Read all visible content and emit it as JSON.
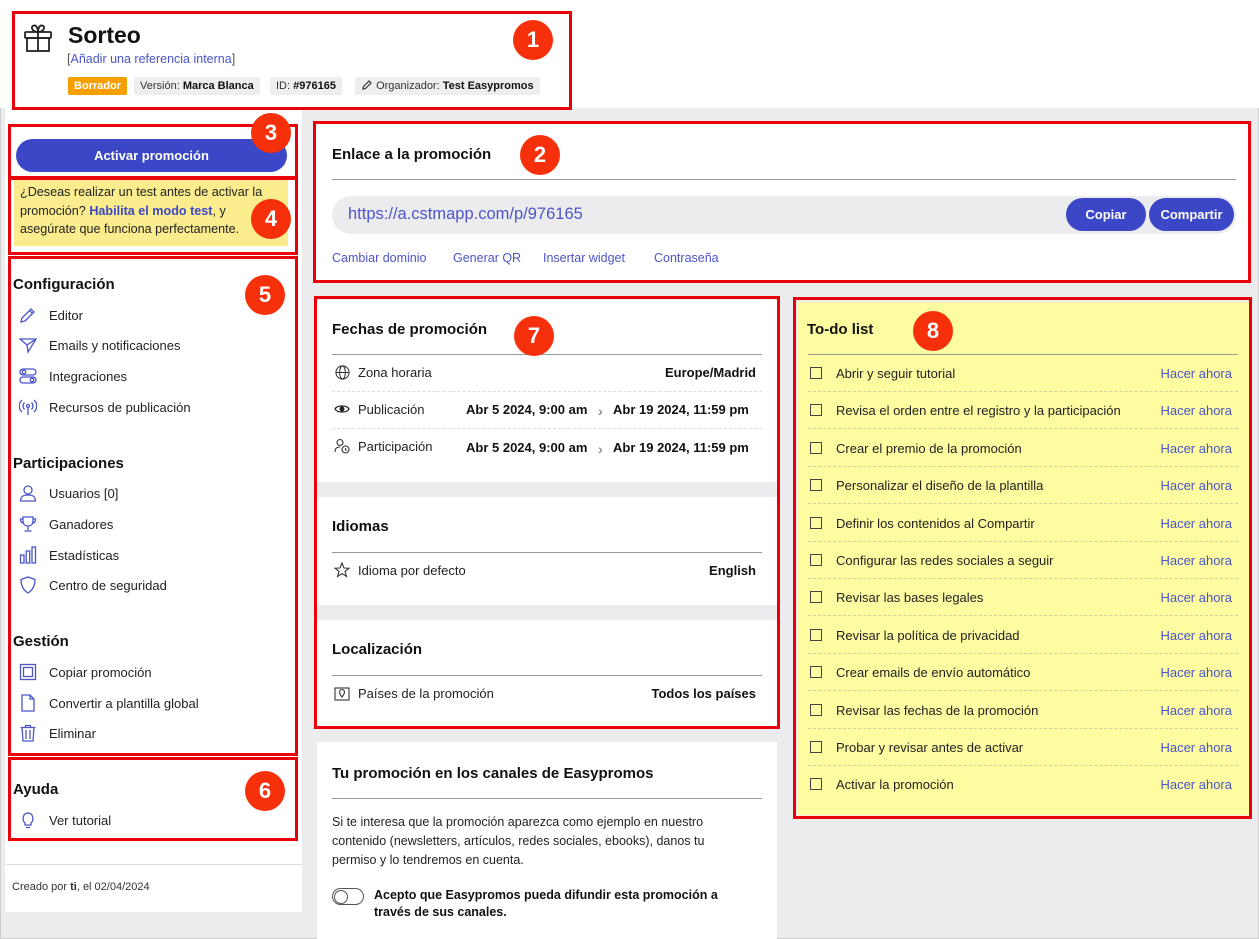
{
  "header": {
    "title": "Sorteo",
    "ref_open": "[",
    "ref_link": "Añadir una referencia interna",
    "ref_close": "]",
    "status": "Borrador",
    "version_label": "Versión:",
    "version_value": "Marca Blanca",
    "id_label": "ID:",
    "id_value": "#976165",
    "organizer_label": "Organizador:",
    "organizer_value": "Test Easypromos"
  },
  "sidebar": {
    "activate_button": "Activar promoción",
    "notice_text_1": "¿Deseas realizar un test antes de activar la promoción?",
    "notice_link": "Habilita el modo test",
    "notice_text_2": ", y asegúrate que funciona perfectamente.",
    "sections": [
      {
        "title": "Configuración",
        "items": [
          {
            "label": "Editor",
            "icon": "pencil-icon"
          },
          {
            "label": "Emails y notificaciones",
            "icon": "send-icon"
          },
          {
            "label": "Integraciones",
            "icon": "toggles-icon"
          },
          {
            "label": "Recursos de publicación",
            "icon": "broadcast-icon"
          }
        ]
      },
      {
        "title": "Participaciones",
        "items": [
          {
            "label": "Usuarios [0]",
            "icon": "user-icon"
          },
          {
            "label": "Ganadores",
            "icon": "trophy-icon"
          },
          {
            "label": "Estadísticas",
            "icon": "bar-chart-icon"
          },
          {
            "label": "Centro de seguridad",
            "icon": "shield-icon"
          }
        ]
      },
      {
        "title": "Gestión",
        "items": [
          {
            "label": "Copiar promoción",
            "icon": "copy-icon"
          },
          {
            "label": "Convertir a plantilla global",
            "icon": "file-icon"
          },
          {
            "label": "Eliminar",
            "icon": "trash-icon"
          }
        ]
      },
      {
        "title": "Ayuda",
        "items": [
          {
            "label": "Ver tutorial",
            "icon": "lightbulb-icon"
          }
        ]
      }
    ],
    "created_prefix": "Creado por ",
    "created_by": "ti",
    "created_suffix": ", el 02/04/2024"
  },
  "link_card": {
    "title": "Enlace a la promoción",
    "url": "https://a.cstmapp.com/p/976165",
    "copy_button": "Copiar",
    "share_button": "Compartir",
    "actions": [
      "Cambiar dominio",
      "Generar QR",
      "Insertar widget",
      "Contraseña"
    ]
  },
  "dates_card": {
    "title": "Fechas de promoción",
    "timezone_label": "Zona horaria",
    "timezone_value": "Europe/Madrid",
    "publication_label": "Publicación",
    "publication_start": "Abr 5 2024, 9:00 am",
    "publication_end": "Abr 19 2024, 11:59 pm",
    "participation_label": "Participación",
    "participation_start": "Abr 5 2024, 9:00 am",
    "participation_end": "Abr 19 2024, 11:59 pm"
  },
  "languages_card": {
    "title": "Idiomas",
    "default_label": "Idioma por defecto",
    "default_value": "English"
  },
  "location_card": {
    "title": "Localización",
    "countries_label": "Países de la promoción",
    "countries_value": "Todos los países"
  },
  "channels_card": {
    "title": "Tu promoción en los canales de Easypromos",
    "description": "Si te interesa que la promoción aparezca como ejemplo en nuestro contenido (newsletters, artículos, redes sociales, ebooks), danos tu permiso y lo tendremos en cuenta.",
    "toggle_label": "Acepto que Easypromos pueda difundir esta promoción a través de sus canales.",
    "toggle_on": false
  },
  "todo": {
    "title": "To-do list",
    "action_label": "Hacer ahora",
    "items": [
      "Abrir y seguir tutorial",
      "Revisa el orden entre el registro y la participación",
      "Crear el premio de la promoción",
      "Personalizar el diseño de la plantilla",
      "Definir los contenidos al Compartir",
      "Configurar las redes sociales a seguir",
      "Revisar las bases legales",
      "Revisar la política de privacidad",
      "Crear emails de envío automático",
      "Revisar las fechas de la promoción",
      "Probar y revisar antes de activar",
      "Activar la promoción"
    ]
  },
  "annotations": [
    "1",
    "2",
    "3",
    "4",
    "5",
    "6",
    "7",
    "8"
  ],
  "colors": {
    "accent": "#3b47c7",
    "draft": "#f5a000",
    "annotation_red": "#e8000b",
    "notice_yellow": "#fbed8d",
    "todo_yellow": "#fdfca0"
  }
}
